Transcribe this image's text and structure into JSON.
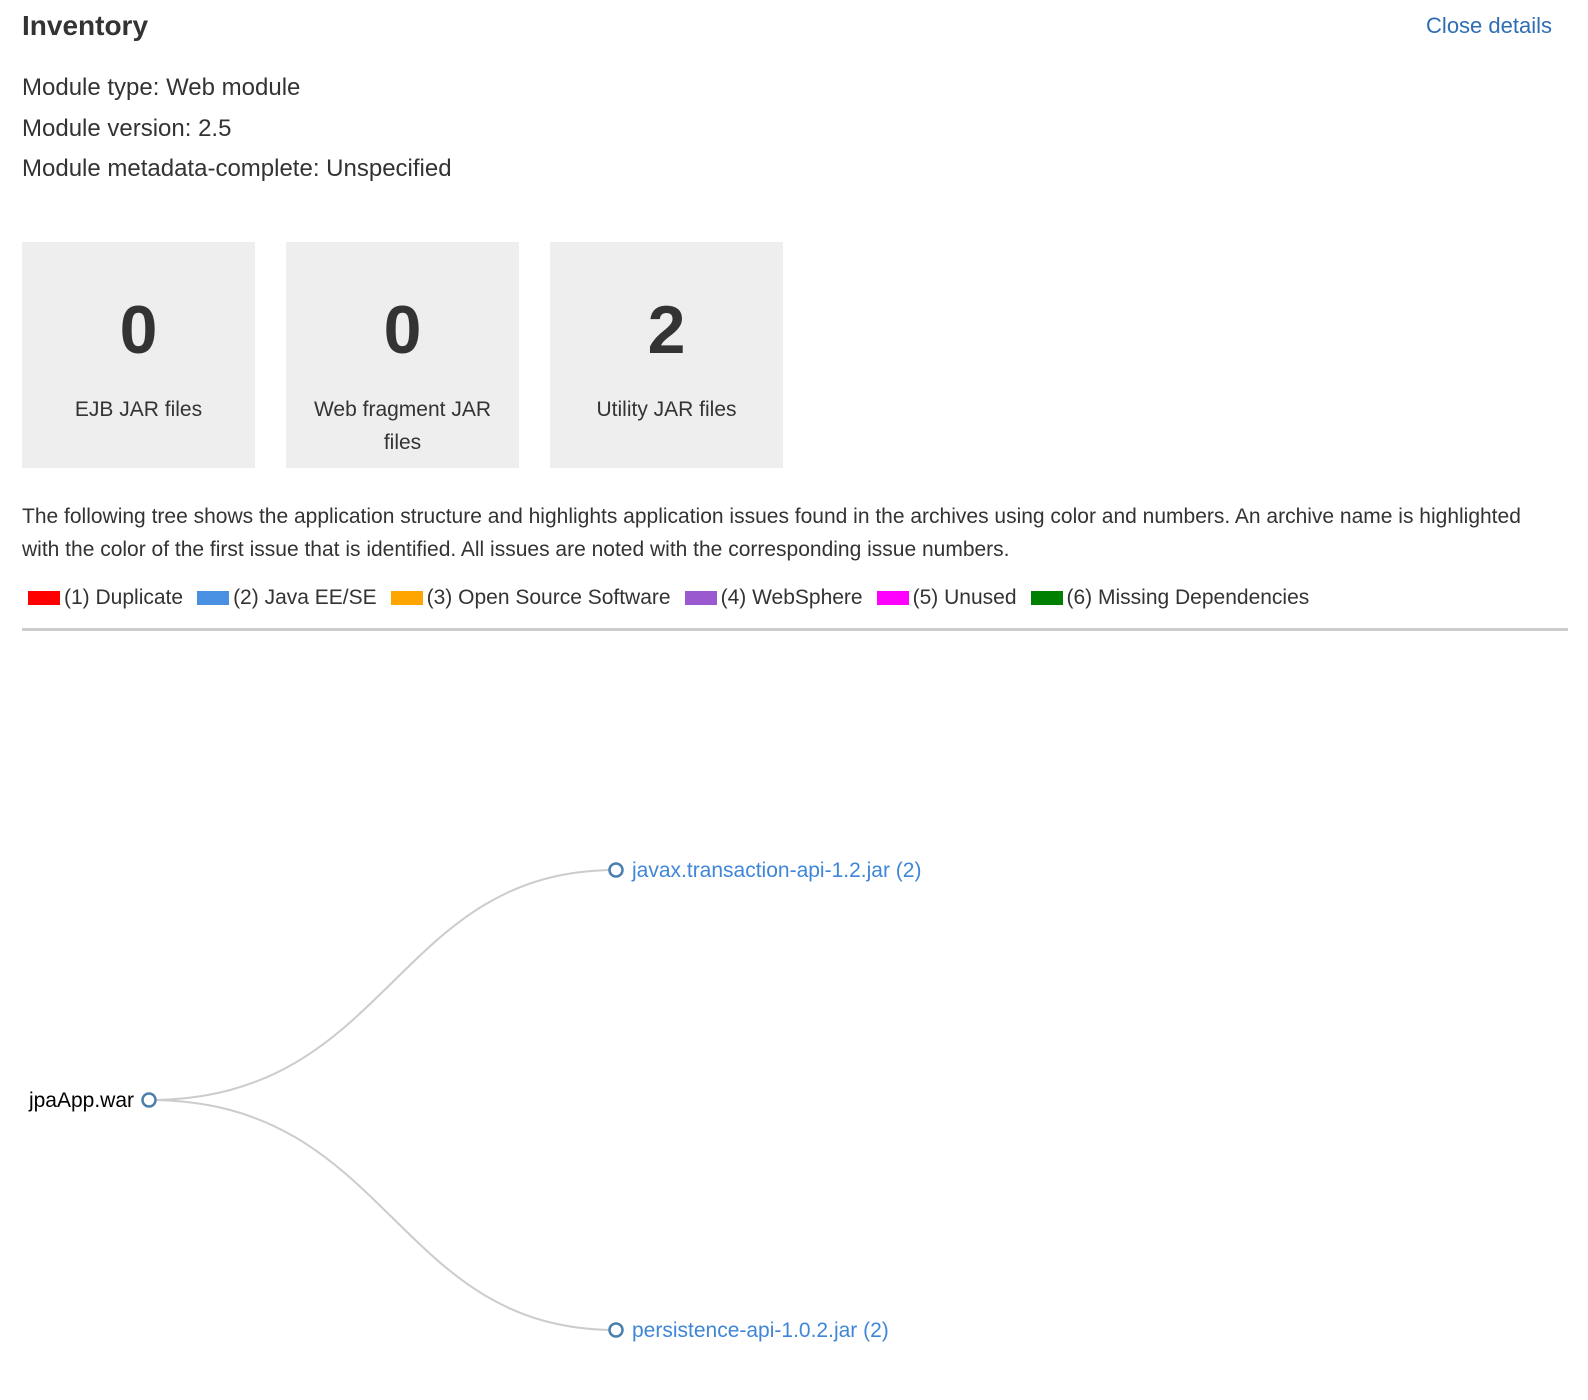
{
  "header": {
    "title": "Inventory",
    "close_label": "Close details"
  },
  "module": {
    "type_line": "Module type: Web module",
    "version_line": "Module version: 2.5",
    "metadata_line": "Module metadata-complete: Unspecified"
  },
  "cards": [
    {
      "count": "0",
      "label": "EJB JAR files"
    },
    {
      "count": "0",
      "label": "Web fragment JAR files"
    },
    {
      "count": "2",
      "label": "Utility JAR files"
    }
  ],
  "description": "The following tree shows the application structure and highlights application issues found in the archives using color and numbers. An archive name is highlighted with the color of the first issue that is identified. All issues are noted with the corresponding issue numbers.",
  "legend": [
    {
      "label": "(1) Duplicate",
      "color": "#ff0000"
    },
    {
      "label": "(2) Java EE/SE",
      "color": "#4a90e2"
    },
    {
      "label": "(3) Open Source Software",
      "color": "#ffa500"
    },
    {
      "label": "(4) WebSphere",
      "color": "#9b59d0"
    },
    {
      "label": "(5) Unused",
      "color": "#ff00ff"
    },
    {
      "label": "(6) Missing Dependencies",
      "color": "#008000"
    }
  ],
  "tree": {
    "root": {
      "label": "jpaApp.war"
    },
    "children": [
      {
        "label": "javax.transaction-api-1.2.jar (2)",
        "issue_color": "#3f86d8"
      },
      {
        "label": "persistence-api-1.0.2.jar (2)",
        "issue_color": "#3f86d8"
      }
    ]
  }
}
